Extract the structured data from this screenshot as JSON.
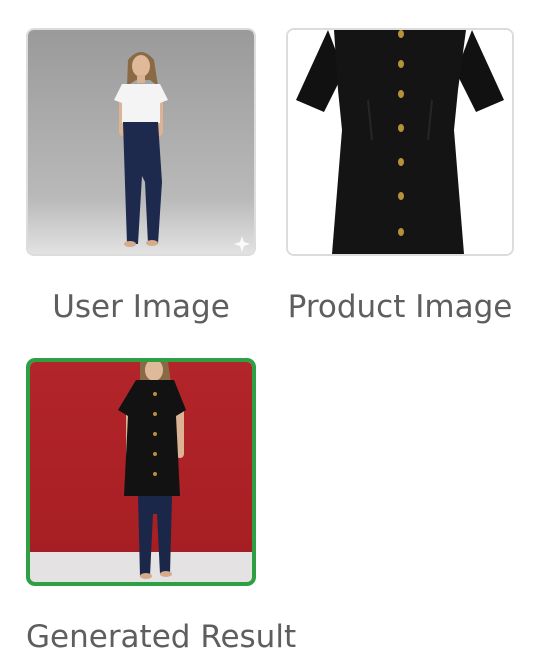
{
  "gallery": {
    "items": [
      {
        "label": "User Image",
        "selected": false,
        "icon": "sparkle-icon"
      },
      {
        "label": "Product Image",
        "selected": false
      },
      {
        "label": "Generated Result",
        "selected": true
      }
    ]
  },
  "colors": {
    "selected_border": "#2ea043",
    "card_border": "#dcdcdc",
    "caption_text": "#5e5e5e",
    "generated_backdrop": "#b8262b"
  }
}
